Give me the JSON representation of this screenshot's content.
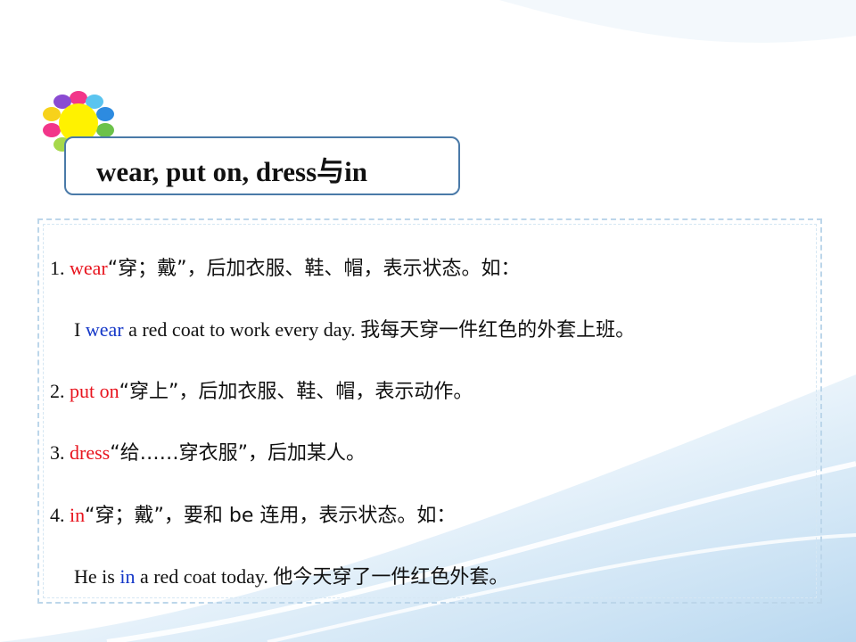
{
  "title": "wear, put on, dress与in",
  "colors": {
    "red": "#e8141e",
    "blue": "#1437c8",
    "border": "#4a7aa8"
  },
  "items": [
    {
      "num": "1.",
      "keyword": "wear",
      "text": "“穿；戴”，后加衣服、鞋、帽，表示状态。如："
    },
    {
      "pre": "I",
      "keyword": "wear",
      "post": "a red coat to work every day.",
      "cn": "我每天穿一件红色的外套上班。"
    },
    {
      "num": "2.",
      "keyword": "put on",
      "text": "“穿上”，后加衣服、鞋、帽，表示动作。"
    },
    {
      "num": "3.",
      "keyword": "dress",
      "text": "“给……穿衣服”，后加某人。"
    },
    {
      "num": "4.",
      "keyword": "in",
      "text": "“穿；戴”，要和 be 连用，表示状态。如："
    },
    {
      "pre": "He is",
      "keyword": "in",
      "post": "a red coat today.",
      "cn": "他今天穿了一件红色外套。"
    }
  ]
}
